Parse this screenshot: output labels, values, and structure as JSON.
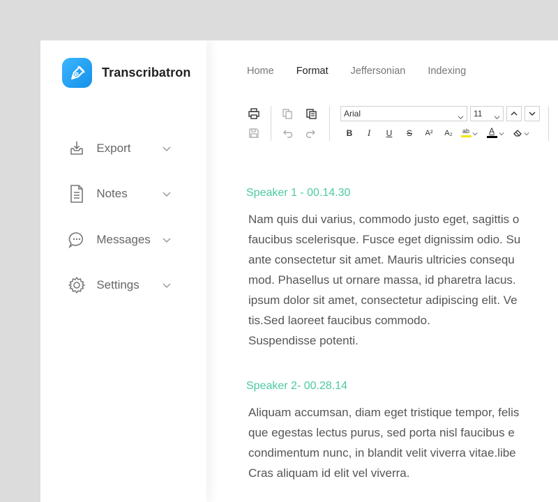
{
  "app": {
    "name": "Transcribatron"
  },
  "sidebar": {
    "items": [
      {
        "label": "Export"
      },
      {
        "label": "Notes"
      },
      {
        "label": "Messages"
      },
      {
        "label": "Settings"
      }
    ]
  },
  "tabs": [
    {
      "label": "Home",
      "active": false
    },
    {
      "label": "Format",
      "active": true
    },
    {
      "label": "Jeffersonian",
      "active": false
    },
    {
      "label": "Indexing",
      "active": false
    }
  ],
  "toolbar": {
    "font": "Arial",
    "size": "11",
    "bold": "B",
    "italic": "I",
    "underline": "U",
    "strike": "S",
    "superscript": "A²",
    "subscript": "A₂",
    "highlight": "ab",
    "font_color": "A",
    "highlight_color": "#f2e600",
    "font_color_value": "#000000"
  },
  "transcript": [
    {
      "speaker": "Speaker 1 - 00.14.30",
      "lines": [
        "Nam quis dui varius, commodo justo eget, sagittis o",
        "faucibus scelerisque. Fusce eget dignissim odio. Su",
        "ante consectetur sit amet. Mauris ultricies consequ",
        "mod. Phasellus ut ornare massa, id pharetra lacus.",
        "ipsum dolor sit amet, consectetur adipiscing elit. Ve",
        "tis.Sed laoreet faucibus commodo.",
        "Suspendisse potenti."
      ]
    },
    {
      "speaker": "Speaker 2- 00.28.14",
      "lines": [
        "Aliquam accumsan, diam eget tristique tempor, felis",
        "que egestas lectus purus, sed porta nisl faucibus e",
        "condimentum nunc, in blandit velit viverra vitae.libe",
        "Cras aliquam id elit vel viverra."
      ]
    }
  ],
  "colors": {
    "accent": "#4cc9a3",
    "brand": "#1f9df0"
  }
}
